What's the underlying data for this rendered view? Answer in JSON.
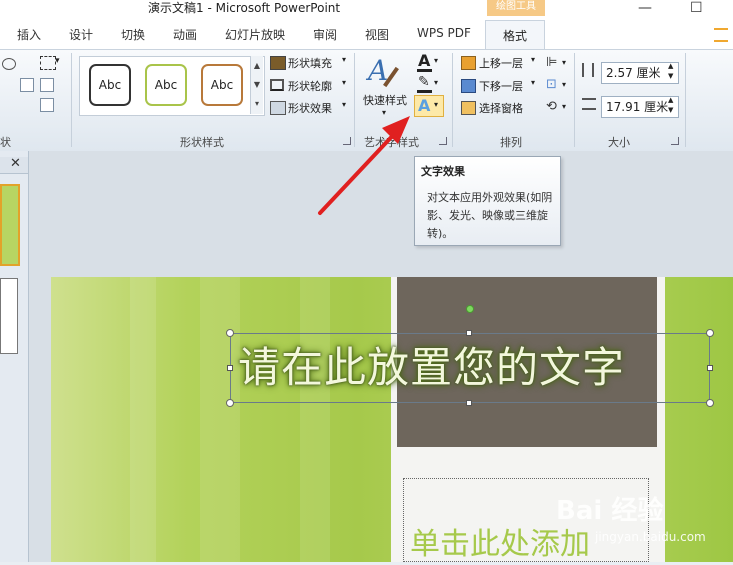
{
  "window": {
    "title": "演示文稿1  -  Microsoft PowerPoint",
    "context_group": "绘图工具"
  },
  "tabs": [
    "插入",
    "设计",
    "切换",
    "动画",
    "幻灯片放映",
    "审阅",
    "视图",
    "WPS PDF"
  ],
  "active_tab": "格式",
  "ribbon": {
    "shape_styles": {
      "label": "形状样式",
      "gallery": [
        "Abc",
        "Abc",
        "Abc"
      ],
      "fill": "形状填充",
      "outline": "形状轮廓",
      "effects": "形状效果"
    },
    "art_styles": {
      "label": "艺术字样式",
      "quick_styles": "快速样式"
    },
    "arrange": {
      "label": "排列",
      "bring_forward": "上移一层",
      "send_backward": "下移一层",
      "selection_pane": "选择窗格"
    },
    "size": {
      "label": "大小",
      "height": "2.57 厘米",
      "width": "17.91 厘米"
    },
    "left_group_label": "状"
  },
  "tooltip": {
    "title": "文字效果",
    "body": "对文本应用外观效果(如阴影、发光、映像或三维旋转)。"
  },
  "slide": {
    "title_text": "请在此放置您的文字",
    "subtitle_text": "单击此处添加"
  },
  "watermark": {
    "text": "Bai 经验",
    "url": "jingyan.baidu.com"
  },
  "colors": {
    "accent_context": "#f6c986",
    "arrow": "#e02020"
  }
}
